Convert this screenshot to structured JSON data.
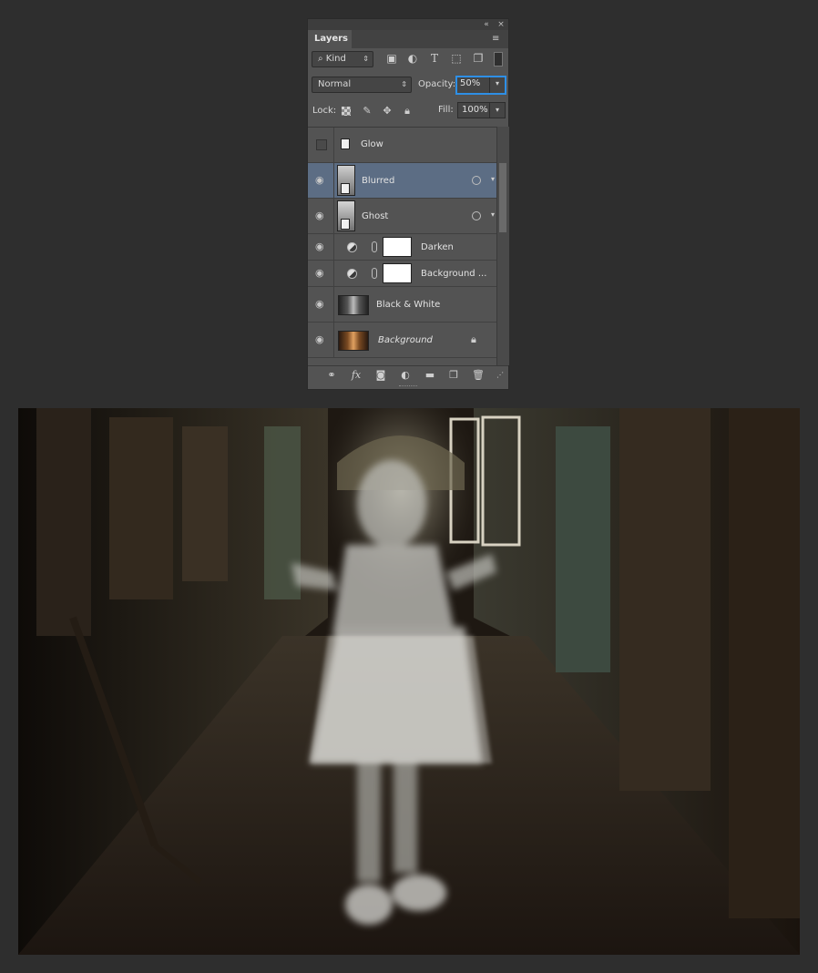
{
  "panel": {
    "tab_label": "Layers",
    "collapse_icon": "«",
    "close_icon": "×",
    "menu_icon": "≡",
    "filter": {
      "kind_label": "Kind",
      "kind_prefix": "⌕"
    },
    "blend_mode": "Normal",
    "opacity_label": "Opacity:",
    "opacity_value": "50%",
    "lock_label": "Lock:",
    "fill_label": "Fill:",
    "fill_value": "100%"
  },
  "layers": [
    {
      "name": "Glow",
      "visible": false,
      "selected": false,
      "type": "smart-object"
    },
    {
      "name": "Blurred",
      "visible": true,
      "selected": true,
      "type": "smart-object"
    },
    {
      "name": "Ghost",
      "visible": true,
      "selected": false,
      "type": "smart-object"
    },
    {
      "name": "Darken",
      "visible": true,
      "selected": false,
      "type": "adjustment"
    },
    {
      "name": "Background ...",
      "visible": true,
      "selected": false,
      "type": "adjustment"
    },
    {
      "name": "Black & White",
      "visible": true,
      "selected": false,
      "type": "image"
    },
    {
      "name": "Background",
      "visible": true,
      "selected": false,
      "type": "background",
      "locked": true
    }
  ],
  "colors": {
    "panel_bg": "#535353",
    "selected_row": "#5c6d84",
    "focus_ring": "#2e8fe6",
    "page_bg": "#2e2e2e"
  }
}
